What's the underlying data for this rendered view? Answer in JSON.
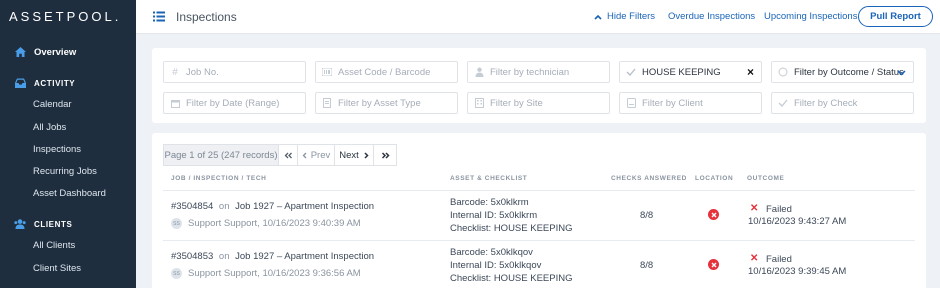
{
  "app": {
    "logo": "ASSETPOOL."
  },
  "sidebar": {
    "overview": "Overview",
    "activity_section": "ACTIVITY",
    "activity_items": [
      "Calendar",
      "All Jobs",
      "Inspections",
      "Recurring Jobs",
      "Asset Dashboard"
    ],
    "clients_section": "CLIENTS",
    "clients_items": [
      "All Clients",
      "Client Sites"
    ]
  },
  "header": {
    "title": "Inspections",
    "hide_filters": "Hide Filters",
    "overdue": "Overdue Inspections",
    "upcoming": "Upcoming Inspections",
    "pull_report": "Pull Report"
  },
  "filters": {
    "job_no": "Job No.",
    "asset_code": "Asset Code / Barcode",
    "technician": "Filter by technician",
    "checklist_value": "HOUSE KEEPING",
    "outcome": "Filter by Outcome / Status",
    "date_range": "Filter by Date (Range)",
    "asset_type": "Filter by Asset Type",
    "site": "Filter by Site",
    "client": "Filter by Client",
    "check": "Filter by Check"
  },
  "pager": {
    "info": "Page 1 of 25 (247 records)",
    "prev": "Prev",
    "next": "Next"
  },
  "table": {
    "headers": {
      "job": "JOB / INSPECTION / TECH",
      "asset": "ASSET & CHECKLIST",
      "checks": "CHECKS ANSWERED",
      "location": "LOCATION",
      "outcome": "OUTCOME"
    },
    "rows": [
      {
        "id": "#3504854",
        "on": "on",
        "job": "Job 1927 – Apartment Inspection",
        "tech": "Support Support, 10/16/2023 9:40:39 AM",
        "barcode": "Barcode: 5x0klkrm",
        "internal": "Internal ID: 5x0klkrm",
        "checklist": "Checklist: HOUSE KEEPING",
        "checks": "8/8",
        "outcome": "Failed",
        "outcome_time": "10/16/2023 9:43:27 AM"
      },
      {
        "id": "#3504853",
        "on": "on",
        "job": "Job 1927 – Apartment Inspection",
        "tech": "Support Support, 10/16/2023 9:36:56 AM",
        "barcode": "Barcode: 5x0klkqov",
        "internal": "Internal ID: 5x0klkqov",
        "checklist": "Checklist: HOUSE KEEPING",
        "checks": "8/8",
        "outcome": "Failed",
        "outcome_time": "10/16/2023 9:39:45 AM"
      }
    ]
  },
  "colors": {
    "sidebar_bg": "#1e2e3e",
    "accent": "#1a64b8",
    "failed": "#e5323b"
  }
}
